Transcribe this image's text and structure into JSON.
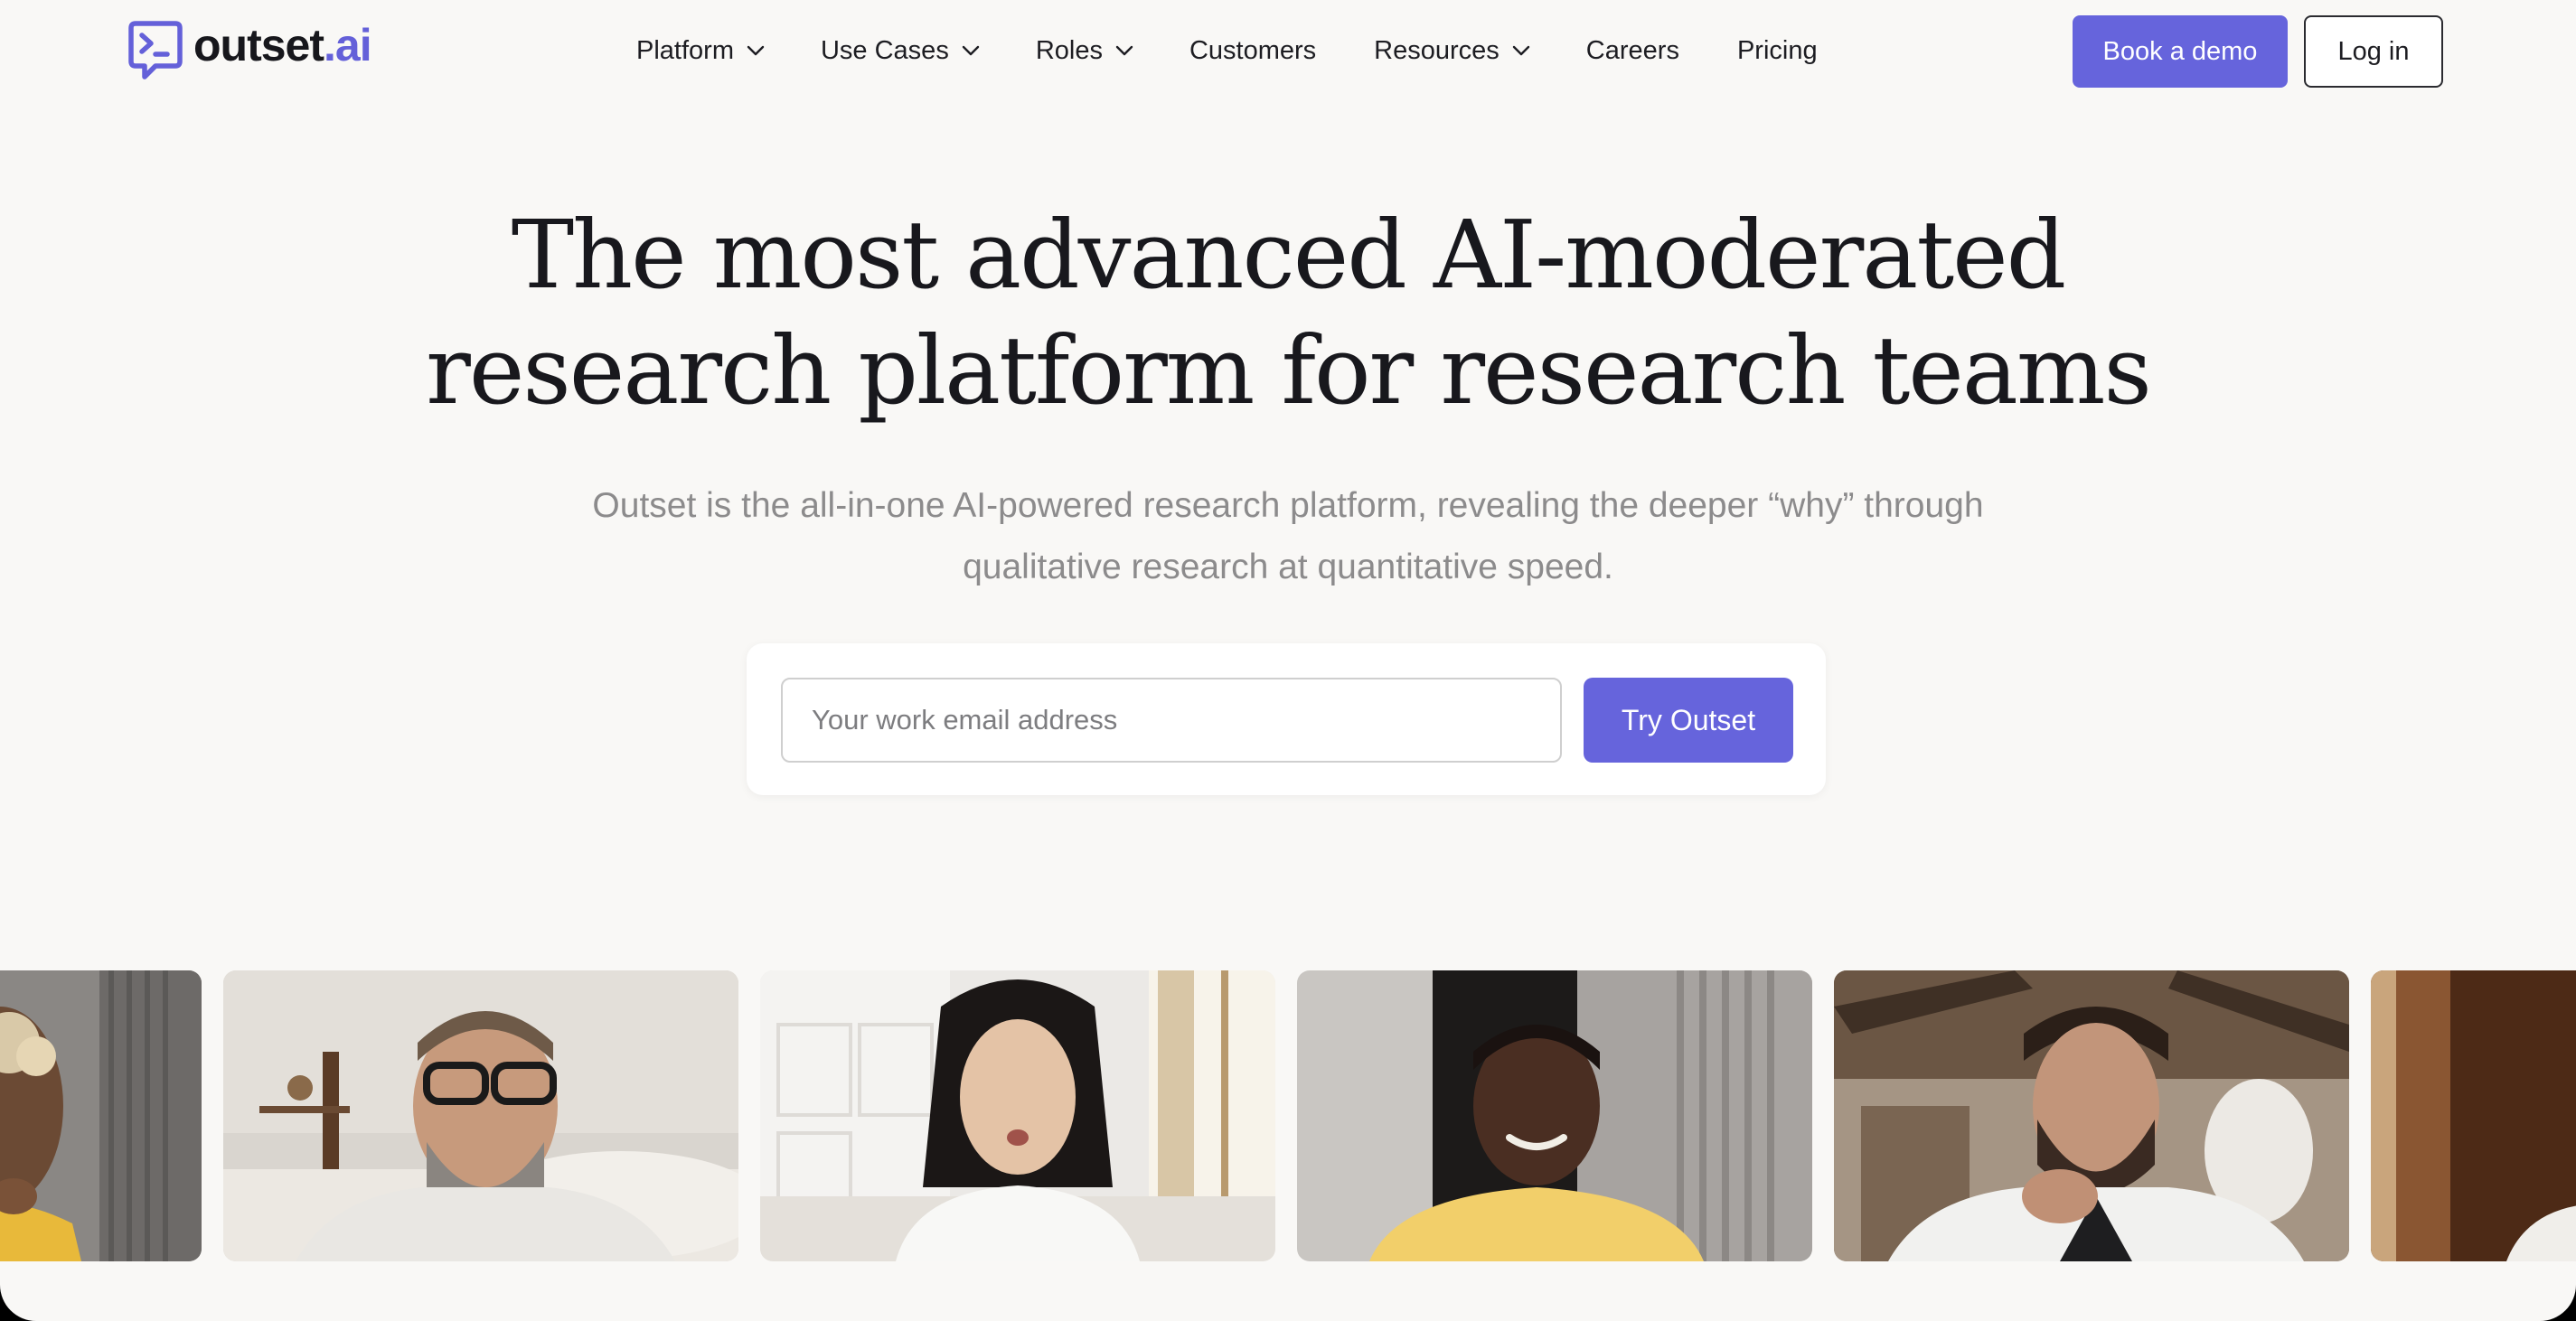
{
  "brand": {
    "name": "outset",
    "suffix": ".ai",
    "accent_color": "#6664dc",
    "logo_icon": "chat-terminal-icon"
  },
  "nav": {
    "items": [
      {
        "label": "Platform",
        "has_dropdown": true
      },
      {
        "label": "Use Cases",
        "has_dropdown": true
      },
      {
        "label": "Roles",
        "has_dropdown": true
      },
      {
        "label": "Customers",
        "has_dropdown": false
      },
      {
        "label": "Resources",
        "has_dropdown": true
      },
      {
        "label": "Careers",
        "has_dropdown": false
      },
      {
        "label": "Pricing",
        "has_dropdown": false
      }
    ],
    "dropdown_icon": "chevron-down-icon"
  },
  "header": {
    "demo_label": "Book a demo",
    "login_label": "Log in"
  },
  "hero": {
    "title_line1": "The most advanced AI-moderated",
    "title_line2": "research platform for research teams",
    "subtitle_line1": "Outset is the all-in-one AI-powered research platform, revealing the deeper “why” through",
    "subtitle_line2": "qualitative research at quantitative speed."
  },
  "signup": {
    "email_placeholder": "Your work email address",
    "email_value": "",
    "submit_label": "Try Outset"
  },
  "video_strip": {
    "participants": [
      "participant-video-1",
      "participant-video-2",
      "participant-video-3",
      "participant-video-4",
      "participant-video-5",
      "participant-video-6"
    ]
  }
}
